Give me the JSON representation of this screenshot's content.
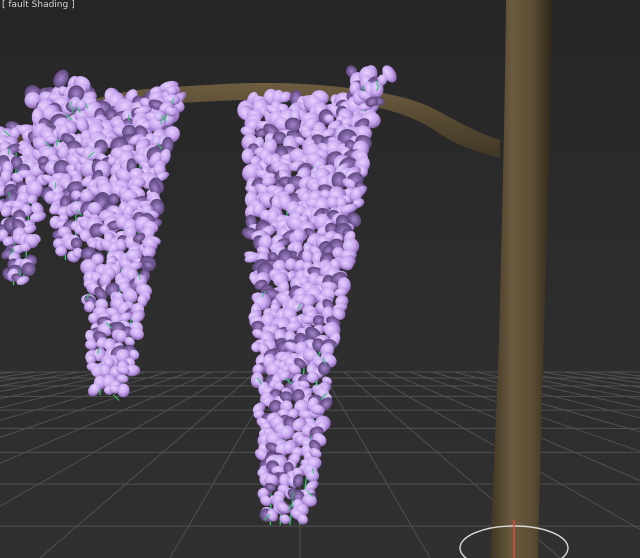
{
  "viewport": {
    "label": "[ fault Shading ]",
    "shading_mode": "Default Shading"
  },
  "scene": {
    "background_color": "#2b2b2b",
    "grid_color": "#505050",
    "trunk_color": "#5f5138",
    "branch_color": "#5c4f36",
    "flower_color": "#c8a7ef",
    "flower_shadow_color": "#8563b0",
    "stem_color": "#34c470"
  },
  "gizmo": {
    "icon": "view-cube-compass-icon"
  }
}
